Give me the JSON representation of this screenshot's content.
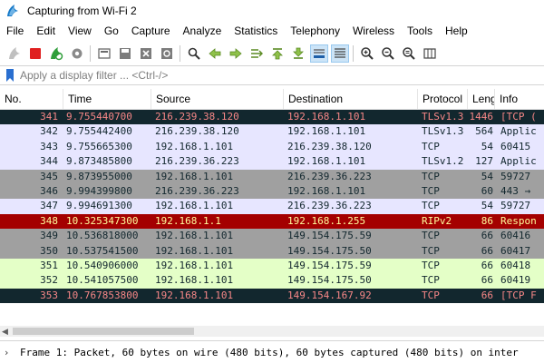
{
  "window": {
    "title": "Capturing from Wi-Fi 2"
  },
  "menu": [
    "File",
    "Edit",
    "View",
    "Go",
    "Capture",
    "Analyze",
    "Statistics",
    "Telephony",
    "Wireless",
    "Tools",
    "Help"
  ],
  "toolbar": {
    "icons": [
      "shark-fin-start-icon",
      "stop-square-icon",
      "restart-capture-icon",
      "capture-options-gear-icon",
      "open-folder-icon",
      "save-file-icon",
      "close-file-icon",
      "reload-icon",
      "find-packet-icon",
      "go-back-arrow-icon",
      "go-forward-arrow-icon",
      "go-to-packet-icon",
      "go-to-first-icon",
      "go-to-last-icon",
      "auto-scroll-icon",
      "colorize-icon",
      "zoom-in-icon",
      "zoom-out-icon",
      "zoom-normal-icon",
      "resize-columns-icon"
    ],
    "active": [
      "auto-scroll-icon",
      "colorize-icon"
    ]
  },
  "filter": {
    "placeholder": "Apply a display filter ... <Ctrl-/>"
  },
  "columns": [
    "No.",
    "Time",
    "Source",
    "Destination",
    "Protocol",
    "Length",
    "Info"
  ],
  "colors": {
    "tcp_bad": {
      "bg": "#12272e",
      "fg": "#f78787"
    },
    "tls": {
      "bg": "#e7e6ff",
      "fg": "#12272e"
    },
    "tcp_syn": {
      "bg": "#a0a0a0",
      "fg": "#12272e"
    },
    "routing": {
      "bg": "#a40000",
      "fg": "#fffc9c"
    },
    "http": {
      "bg": "#e4ffc7",
      "fg": "#12272e"
    }
  },
  "packets": [
    {
      "no": "341",
      "time": "9.755440700",
      "src": "216.239.38.120",
      "dst": "192.168.1.101",
      "proto": "TLSv1.3",
      "len": "1446",
      "info": "[TCP (",
      "style": "tcp_bad"
    },
    {
      "no": "342",
      "time": "9.755442400",
      "src": "216.239.38.120",
      "dst": "192.168.1.101",
      "proto": "TLSv1.3",
      "len": "564",
      "info": "Applic",
      "style": "tls"
    },
    {
      "no": "343",
      "time": "9.755665300",
      "src": "192.168.1.101",
      "dst": "216.239.38.120",
      "proto": "TCP",
      "len": "54",
      "info": "60415",
      "style": "tls"
    },
    {
      "no": "344",
      "time": "9.873485800",
      "src": "216.239.36.223",
      "dst": "192.168.1.101",
      "proto": "TLSv1.2",
      "len": "127",
      "info": "Applic",
      "style": "tls"
    },
    {
      "no": "345",
      "time": "9.873955000",
      "src": "192.168.1.101",
      "dst": "216.239.36.223",
      "proto": "TCP",
      "len": "54",
      "info": "59727",
      "style": "tcp_syn"
    },
    {
      "no": "346",
      "time": "9.994399800",
      "src": "216.239.36.223",
      "dst": "192.168.1.101",
      "proto": "TCP",
      "len": "60",
      "info": "443 →",
      "style": "tcp_syn"
    },
    {
      "no": "347",
      "time": "9.994691300",
      "src": "192.168.1.101",
      "dst": "216.239.36.223",
      "proto": "TCP",
      "len": "54",
      "info": "59727",
      "style": "tls"
    },
    {
      "no": "348",
      "time": "10.325347300",
      "src": "192.168.1.1",
      "dst": "192.168.1.255",
      "proto": "RIPv2",
      "len": "86",
      "info": "Respon",
      "style": "routing"
    },
    {
      "no": "349",
      "time": "10.536818000",
      "src": "192.168.1.101",
      "dst": "149.154.175.59",
      "proto": "TCP",
      "len": "66",
      "info": "60416",
      "style": "tcp_syn"
    },
    {
      "no": "350",
      "time": "10.537541500",
      "src": "192.168.1.101",
      "dst": "149.154.175.50",
      "proto": "TCP",
      "len": "66",
      "info": "60417",
      "style": "tcp_syn"
    },
    {
      "no": "351",
      "time": "10.540906000",
      "src": "192.168.1.101",
      "dst": "149.154.175.59",
      "proto": "TCP",
      "len": "66",
      "info": "60418",
      "style": "http"
    },
    {
      "no": "352",
      "time": "10.541057500",
      "src": "192.168.1.101",
      "dst": "149.154.175.50",
      "proto": "TCP",
      "len": "66",
      "info": "60419",
      "style": "http"
    },
    {
      "no": "353",
      "time": "10.767853800",
      "src": "192.168.1.101",
      "dst": "149.154.167.92",
      "proto": "TCP",
      "len": "66",
      "info": "[TCP F",
      "style": "tcp_bad"
    }
  ],
  "detail": {
    "text": "Frame 1: Packet, 60 bytes on wire (480 bits), 60 bytes captured (480 bits) on inter"
  }
}
